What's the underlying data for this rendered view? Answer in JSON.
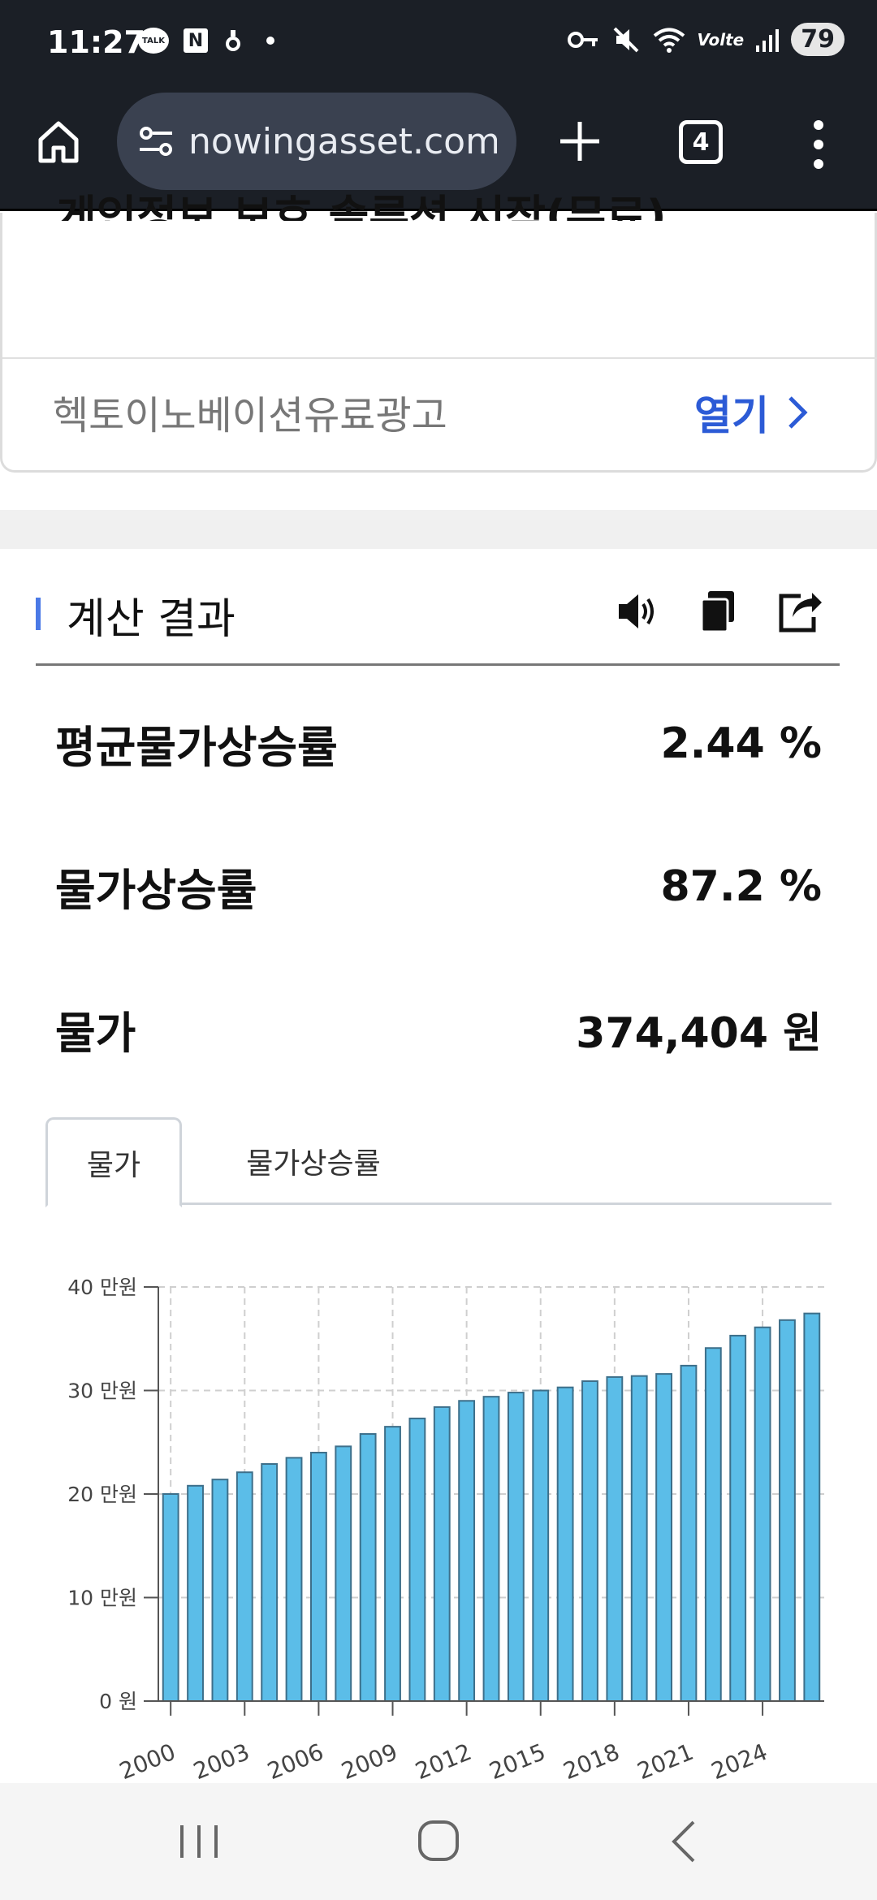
{
  "status_bar": {
    "time": "11:27",
    "talk_badge": "TALK",
    "n_badge": "N",
    "battery": "79",
    "volte": "Volte"
  },
  "browser": {
    "url": "nowingasset.com",
    "tab_count": "4"
  },
  "ad": {
    "partial_title": "게인정보 보호 솔루션 시작(무료)",
    "sponsor": "헥토이노베이션유료광고",
    "open_label": "열기"
  },
  "results": {
    "title": "계산 결과",
    "rows": [
      {
        "label": "평균물가상승률",
        "value": "2.44 %"
      },
      {
        "label": "물가상승률",
        "value": "87.2 %"
      },
      {
        "label": "물가",
        "value": "374,404 원"
      }
    ]
  },
  "chart_tabs": {
    "active": "물가",
    "inactive": "물가상승률"
  },
  "chart_data": {
    "type": "bar",
    "ylim": [
      0,
      400000
    ],
    "ytick_labels": [
      "0 원",
      "10 만원",
      "20 만원",
      "30 만원",
      "40 만원"
    ],
    "xtick_labels": [
      "2000",
      "2003",
      "2006",
      "2009",
      "2012",
      "2015",
      "2018",
      "2021",
      "2024"
    ],
    "categories": [
      "2000",
      "2001",
      "2002",
      "2003",
      "2004",
      "2005",
      "2006",
      "2007",
      "2008",
      "2009",
      "2010",
      "2011",
      "2012",
      "2013",
      "2014",
      "2015",
      "2016",
      "2017",
      "2018",
      "2019",
      "2020",
      "2021",
      "2022",
      "2023",
      "2024",
      "2025"
    ],
    "values": [
      200000,
      208000,
      214000,
      221000,
      229000,
      235000,
      240000,
      246000,
      258000,
      265000,
      273000,
      284000,
      290000,
      294000,
      298000,
      300000,
      303000,
      309000,
      313000,
      314000,
      316000,
      324000,
      341000,
      353000,
      361000,
      368000,
      374404
    ],
    "bar_color": "#5bbde8",
    "bar_edge": "#3d6f8a",
    "grid": true
  },
  "colors": {
    "accent": "#4a79e6",
    "link": "#2c5bd6",
    "dark_bar": "#1b1f26"
  }
}
